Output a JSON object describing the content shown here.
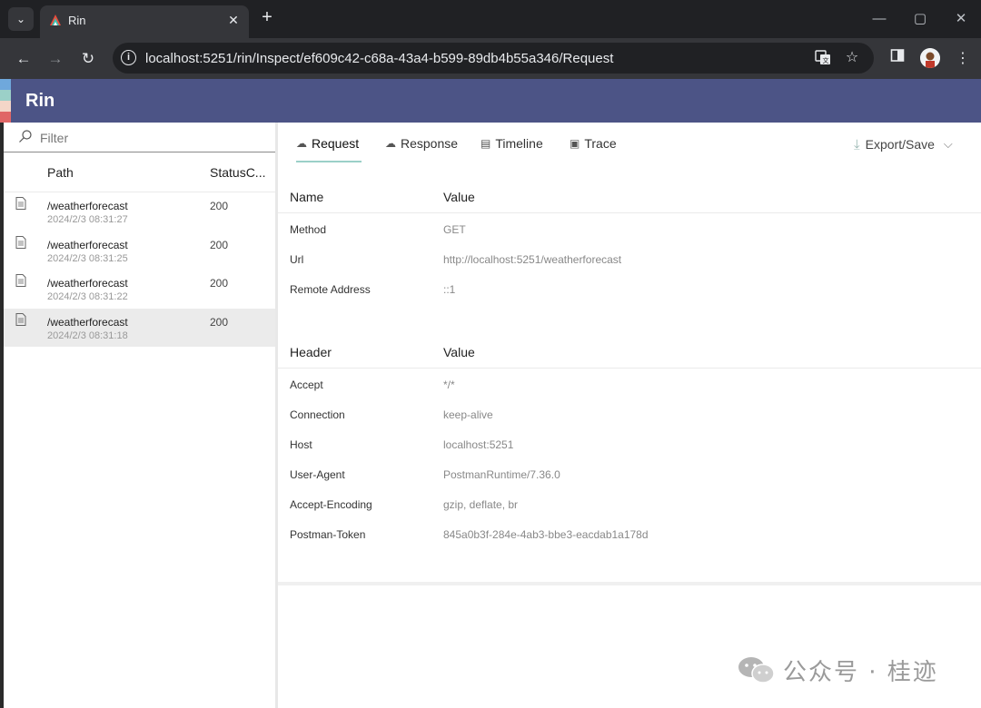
{
  "browser": {
    "tab_title": "Rin",
    "tab_close": "✕",
    "new_tab": "+",
    "url": "localhost:5251/rin/Inspect/ef609c42-c68a-43a4-b599-89db4b55a346/Request"
  },
  "app": {
    "title": "Rin",
    "header_color": "#4c5486",
    "accent_color": "#9bd0c8"
  },
  "sidebar": {
    "filter_placeholder": "Filter",
    "columns": {
      "path": "Path",
      "status": "StatusC..."
    },
    "rows": [
      {
        "path": "/weatherforecast",
        "time": "2024/2/3 08:31:27",
        "status": "200",
        "selected": false
      },
      {
        "path": "/weatherforecast",
        "time": "2024/2/3 08:31:25",
        "status": "200",
        "selected": false
      },
      {
        "path": "/weatherforecast",
        "time": "2024/2/3 08:31:22",
        "status": "200",
        "selected": false
      },
      {
        "path": "/weatherforecast",
        "time": "2024/2/3 08:31:18",
        "status": "200",
        "selected": true
      }
    ]
  },
  "tabs": [
    {
      "label": "Request",
      "icon": "cloud-upload-icon",
      "active": true
    },
    {
      "label": "Response",
      "icon": "cloud-download-icon",
      "active": false
    },
    {
      "label": "Timeline",
      "icon": "timeline-icon",
      "active": false
    },
    {
      "label": "Trace",
      "icon": "trace-icon",
      "active": false
    }
  ],
  "export_label": "Export/Save",
  "request": {
    "head": {
      "name": "Name",
      "value": "Value"
    },
    "rows": [
      {
        "name": "Method",
        "value": "GET"
      },
      {
        "name": "Url",
        "value": "http://localhost:5251/weatherforecast"
      },
      {
        "name": "Remote Address",
        "value": "::1"
      }
    ]
  },
  "headers": {
    "head": {
      "name": "Header",
      "value": "Value"
    },
    "rows": [
      {
        "name": "Accept",
        "value": "*/*"
      },
      {
        "name": "Connection",
        "value": "keep-alive"
      },
      {
        "name": "Host",
        "value": "localhost:5251"
      },
      {
        "name": "User-Agent",
        "value": "PostmanRuntime/7.36.0"
      },
      {
        "name": "Accept-Encoding",
        "value": "gzip, deflate, br"
      },
      {
        "name": "Postman-Token",
        "value": "845a0b3f-284e-4ab3-bbe3-eacdab1a178d"
      }
    ]
  },
  "watermark": "公众号 · 桂迹"
}
